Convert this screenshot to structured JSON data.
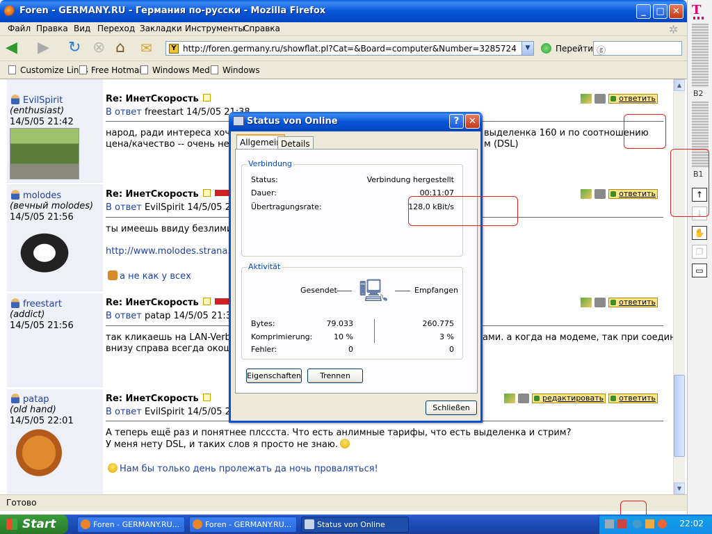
{
  "window": {
    "title": "Foren - GERMANY.RU - Германия по-русски - Mozilla Firefox"
  },
  "menu": [
    "Файл",
    "Правка",
    "Вид",
    "Переход",
    "Закладки",
    "Инструменты",
    "Справка"
  ],
  "nav": {
    "url": "http://foren.germany.ru/showflat.pl?Cat=&Board=computer&Number=3285724&page=0&view=coll",
    "go_label": "Перейти"
  },
  "bookmarks": [
    "Customize Links",
    "Free Hotmail",
    "Windows Media",
    "Windows"
  ],
  "posts": [
    {
      "user": "EvilSpirit",
      "rank": "(enthusiast)",
      "date": "14/5/05 21:42",
      "subject": "Re: ИнетСкорость",
      "reply_label": "В ответ",
      "reply_to": "freestart 14/5/05 21:38",
      "lines": [
        "народ, ради интереса хочу сп",
        "цена/качество -- очень непло"
      ],
      "lines_right": [
        "выделенка 160 и по соотношению",
        "м (DSL)"
      ]
    },
    {
      "user": "molodes",
      "rank": "(вечный molodes)",
      "date": "14/5/05 21:56",
      "subject": "Re: ИнетСкорость",
      "reply_label": "В ответ",
      "reply_to": "EvilSpirit 14/5/05 21:4",
      "lines": [
        "ты имеешь ввиду безлимитн"
      ],
      "link": "http://www.molodes.strana.ge",
      "extra": "а не как у всех"
    },
    {
      "user": "freestart",
      "rank": "(addict)",
      "date": "14/5/05 21:56",
      "subject": "Re: ИнетСкорость",
      "reply_label": "В ответ",
      "reply_to": "patap 14/5/05 21:38",
      "lines": [
        "так кликаешь на LAN-Verbibdu",
        "внизу справа всегда окошко в"
      ],
      "lines_right": [
        "ами. а когда на модеме, так при соединении",
        ""
      ]
    },
    {
      "user": "patap",
      "rank": "(old hand)",
      "date": "14/5/05 22:01",
      "subject": "Re: ИнетСкорость",
      "reply_label": "В ответ",
      "reply_to": "EvilSpirit 14/5/05 21:4",
      "lines": [
        "А теперь ещё раз и понятнее плссста. Что есть анлимные тарифы, что есть выделенка и стрим?",
        "У меня нету DSL, и таких слов я просто не знаю."
      ],
      "footer": "Нам бы только день пролежать да ночь проваляться!"
    }
  ],
  "post_actions": {
    "reply": "ответить",
    "edit": "редактировать"
  },
  "status_text": "Готово",
  "side": {
    "logo": "T",
    "b2": "B2",
    "b1": "B1"
  },
  "dialog": {
    "title": "Status von Online",
    "tabs": [
      "Allgemein",
      "Details"
    ],
    "group1": "Verbindung",
    "status_label": "Status:",
    "status_value": "Verbindung hergestellt",
    "duration_label": "Dauer:",
    "duration_value": "00:11:07",
    "rate_label": "Übertragungsrate:",
    "rate_value": "128,0 kBit/s",
    "group2": "Aktivität",
    "sent_label": "Gesendet",
    "recv_label": "Empfangen",
    "bytes_label": "Bytes:",
    "bytes_sent": "79.033",
    "bytes_recv": "260.775",
    "comp_label": "Komprimierung:",
    "comp_sent": "10 %",
    "comp_recv": "3 %",
    "err_label": "Fehler:",
    "err_sent": "0",
    "err_recv": "0",
    "btn_props": "Eigenschaften",
    "btn_disconnect": "Trennen",
    "btn_close": "Schließen"
  },
  "taskbar": {
    "start": "Start",
    "tasks": [
      "Foren - GERMANY.RU...",
      "Foren - GERMANY.RU...",
      "Status von Online"
    ],
    "clock": "22:02"
  }
}
